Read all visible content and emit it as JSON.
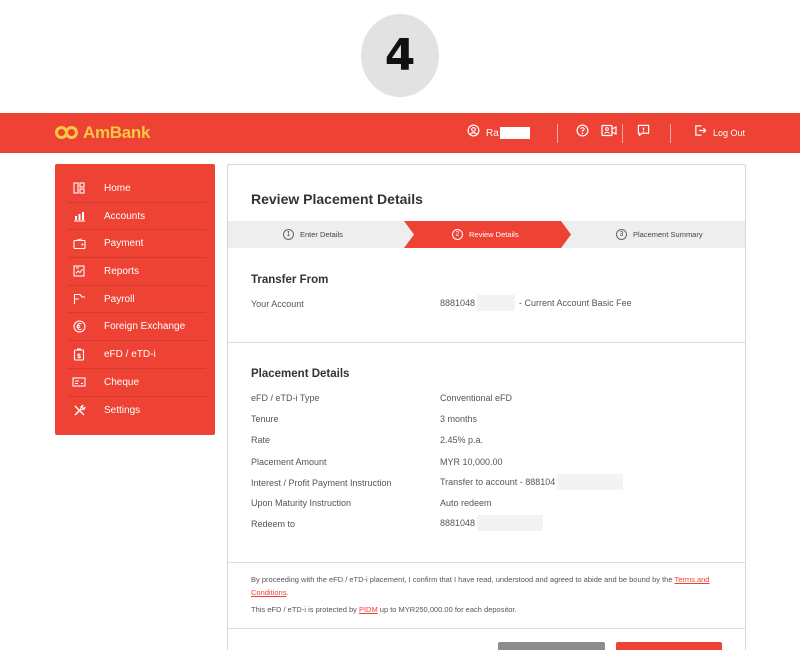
{
  "step_badge": "4",
  "brand": {
    "name": "AmBank",
    "accent": "#ee4234",
    "logo_color": "#f6c944"
  },
  "topbar": {
    "user_name": "Ra",
    "icons": [
      "user-circle-icon",
      "help-icon",
      "video-icon",
      "chat-icon",
      "logout-icon"
    ],
    "logout_label": "Log Out"
  },
  "sidebar": {
    "items": [
      {
        "label": "Home",
        "icon": "home-icon"
      },
      {
        "label": "Accounts",
        "icon": "accounts-icon"
      },
      {
        "label": "Payment",
        "icon": "payment-icon"
      },
      {
        "label": "Reports",
        "icon": "reports-icon"
      },
      {
        "label": "Payroll",
        "icon": "payroll-icon"
      },
      {
        "label": "Foreign Exchange",
        "icon": "euro-icon"
      },
      {
        "label": "eFD / eTD-i",
        "icon": "deposit-icon"
      },
      {
        "label": "Cheque",
        "icon": "cheque-icon"
      },
      {
        "label": "Settings",
        "icon": "settings-icon"
      }
    ]
  },
  "main": {
    "title": "Review Placement Details",
    "steps": [
      {
        "num": "1",
        "label": "Enter Details"
      },
      {
        "num": "2",
        "label": "Review Details"
      },
      {
        "num": "3",
        "label": "Placement Summary"
      }
    ],
    "active_step": 2,
    "transfer_from": {
      "title": "Transfer From",
      "rows": [
        {
          "label": "Your Account",
          "value": "8881048",
          "value_suffix": "- Current Account Basic Fee"
        }
      ]
    },
    "placement": {
      "title": "Placement Details",
      "rows": [
        {
          "label": "eFD / eTD-i Type",
          "value": "Conventional eFD"
        },
        {
          "label": "Tenure",
          "value": "3 months"
        },
        {
          "label": "Rate",
          "value": "2.45% p.a."
        },
        {
          "label": "Placement Amount",
          "value": "MYR 10,000.00"
        },
        {
          "label": "Interest / Profit Payment Instruction",
          "value": "Transfer to account - 888104"
        },
        {
          "label": "Upon Maturity Instruction",
          "value": "Auto redeem"
        },
        {
          "label": "Redeem to",
          "value": "8881048"
        }
      ]
    },
    "terms": {
      "line1": "By proceeding with the eFD / eTD-i placement, I confirm that I have read, understood and agreed to abide and be bound by the ",
      "link1": "Terms and Conditions",
      "line1_end": ".",
      "line2": "This eFD / eTD-i is protected by ",
      "link2": "PIDM",
      "line2_end": " up to MYR250,000.00 for each depositor."
    }
  }
}
